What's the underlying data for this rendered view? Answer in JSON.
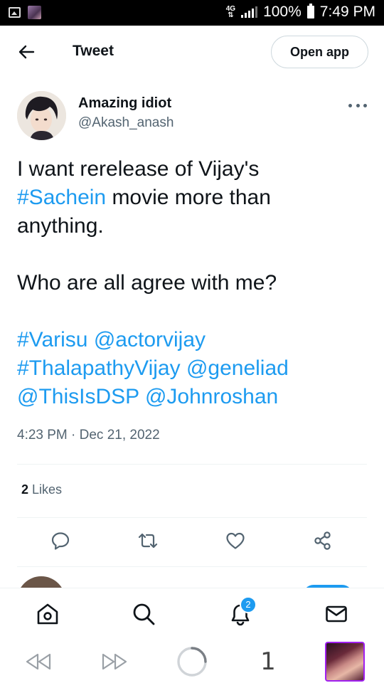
{
  "status_bar": {
    "network": "4G",
    "battery": "100%",
    "time": "7:49 PM"
  },
  "header": {
    "title": "Tweet",
    "open_app": "Open app"
  },
  "tweet": {
    "author_name": "Amazing idiot",
    "author_handle": "@Akash_anash",
    "timestamp": "4:23 PM · Dec 21, 2022",
    "likes_count": "2",
    "likes_label": "Likes"
  },
  "tweet_text": {
    "l1": "I want rerelease of Vijay's",
    "h_sachein": "#Sachein",
    "l2_rest": " movie more than",
    "l3": "anything.",
    "l4": "Who are all agree with me?",
    "h_varisu": "#Varisu",
    "m_actorvijay": "@actorvijay",
    "h_thalapathy": "#ThalapathyVijay",
    "m_geneliad": "@geneliad",
    "m_thisisdsp": "@ThisIsDSP",
    "m_johnroshan": "@Johnroshan"
  },
  "bottom_nav": {
    "notification_count": "2"
  },
  "browser": {
    "tab_count": "1"
  },
  "colors": {
    "accent": "#1d9bf0",
    "text": "#0f1419",
    "secondary": "#536471"
  },
  "icons": [
    "back-arrow-icon",
    "more-icon",
    "reply-icon",
    "retweet-icon",
    "like-icon",
    "share-icon",
    "home-icon",
    "search-icon",
    "bell-icon",
    "mail-icon",
    "rewind-icon",
    "forward-icon",
    "loading-icon"
  ]
}
